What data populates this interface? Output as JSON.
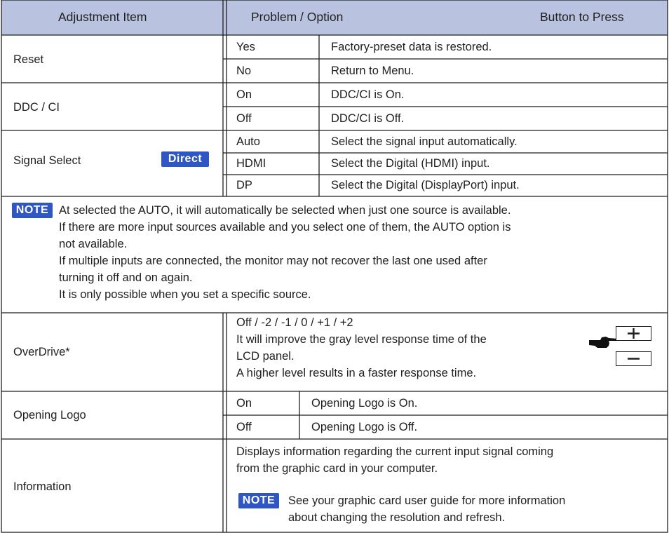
{
  "header": {
    "adjustment_item": "Adjustment Item",
    "problem_option": "Problem / Option",
    "button_to_press": "Button to Press"
  },
  "reset": {
    "label": "Reset",
    "rows": [
      {
        "option": "Yes",
        "description": "Factory-preset data is restored."
      },
      {
        "option": "No",
        "description": "Return to Menu."
      }
    ]
  },
  "ddc": {
    "label": "DDC / CI",
    "rows": [
      {
        "option": "On",
        "description": "DDC/CI is On."
      },
      {
        "option": "Off",
        "description": "DDC/CI is Off."
      }
    ]
  },
  "signal_select": {
    "label": "Signal Select",
    "badge": "Direct",
    "rows": [
      {
        "option": "Auto",
        "description": "Select the signal input automatically."
      },
      {
        "option": "HDMI",
        "description": "Select the Digital (HDMI) input."
      },
      {
        "option": "DP",
        "description": "Select the Digital (DisplayPort) input."
      }
    ]
  },
  "note1": {
    "badge": "NOTE",
    "lines": [
      "At selected the AUTO, it will automatically be selected when just one source is available.",
      "If there are more input sources available and you select one of them, the AUTO option is",
      "not available.",
      "If multiple inputs are connected, the monitor may not recover the last one used after",
      "turning it off and on again.",
      "It is only possible when you set a specific source."
    ]
  },
  "overdrive": {
    "label": "OverDrive*",
    "lines": [
      "Off / -2 / -1 / 0 / +1 / +2",
      "It will improve the gray level response time of the",
      "LCD panel.",
      "A higher level results in a faster response time."
    ],
    "buttons": {
      "plus": "+",
      "minus": "−",
      "pointer_icon": "pointing-hand-icon"
    }
  },
  "opening_logo": {
    "label": "Opening Logo",
    "rows": [
      {
        "option": "On",
        "description": "Opening Logo is On."
      },
      {
        "option": "Off",
        "description": "Opening Logo is Off."
      }
    ]
  },
  "information": {
    "label": "Information",
    "lines": [
      "Displays information regarding the current input signal coming",
      "from the graphic card in your computer."
    ],
    "note_badge": "NOTE",
    "note_lines": [
      "See your graphic card user guide for more information",
      "about changing the resolution and refresh."
    ]
  },
  "colors": {
    "header_bg": "#b9c3e0",
    "badge_bg": "#2f57c3",
    "line": "#1f1f1f"
  }
}
